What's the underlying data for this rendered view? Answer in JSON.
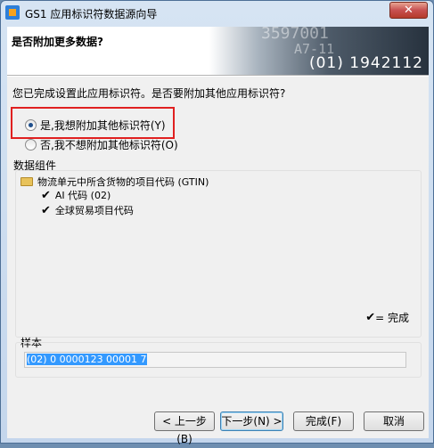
{
  "window": {
    "title": "GS1 应用标识符数据源向导",
    "close_glyph": "✕"
  },
  "header": {
    "title": "是否附加更多数据?",
    "banner_code": "(01) 1942112",
    "banner_faint_1": "3597001",
    "banner_faint_2": "A7-11"
  },
  "question": "您已完成设置此应用标识符。是否要附加其他应用标识符?",
  "options": [
    {
      "label": "是,我想附加其他标识符(Y)",
      "checked": true
    },
    {
      "label": "否,我不想附加其他标识符(O)",
      "checked": false
    }
  ],
  "components": {
    "label": "数据组件",
    "root": "物流单元中所含货物的项目代码 (GTIN)",
    "children": [
      "AI 代码 (02)",
      "全球贸易项目代码"
    ],
    "check_glyph": "✔",
    "legend": "= 完成"
  },
  "sample": {
    "label": "样本",
    "value": "(02) 0 0000123 00001 7"
  },
  "buttons": {
    "back": "< 上一步(B)",
    "next": "下一步(N) >",
    "finish": "完成(F)",
    "cancel": "取消"
  }
}
